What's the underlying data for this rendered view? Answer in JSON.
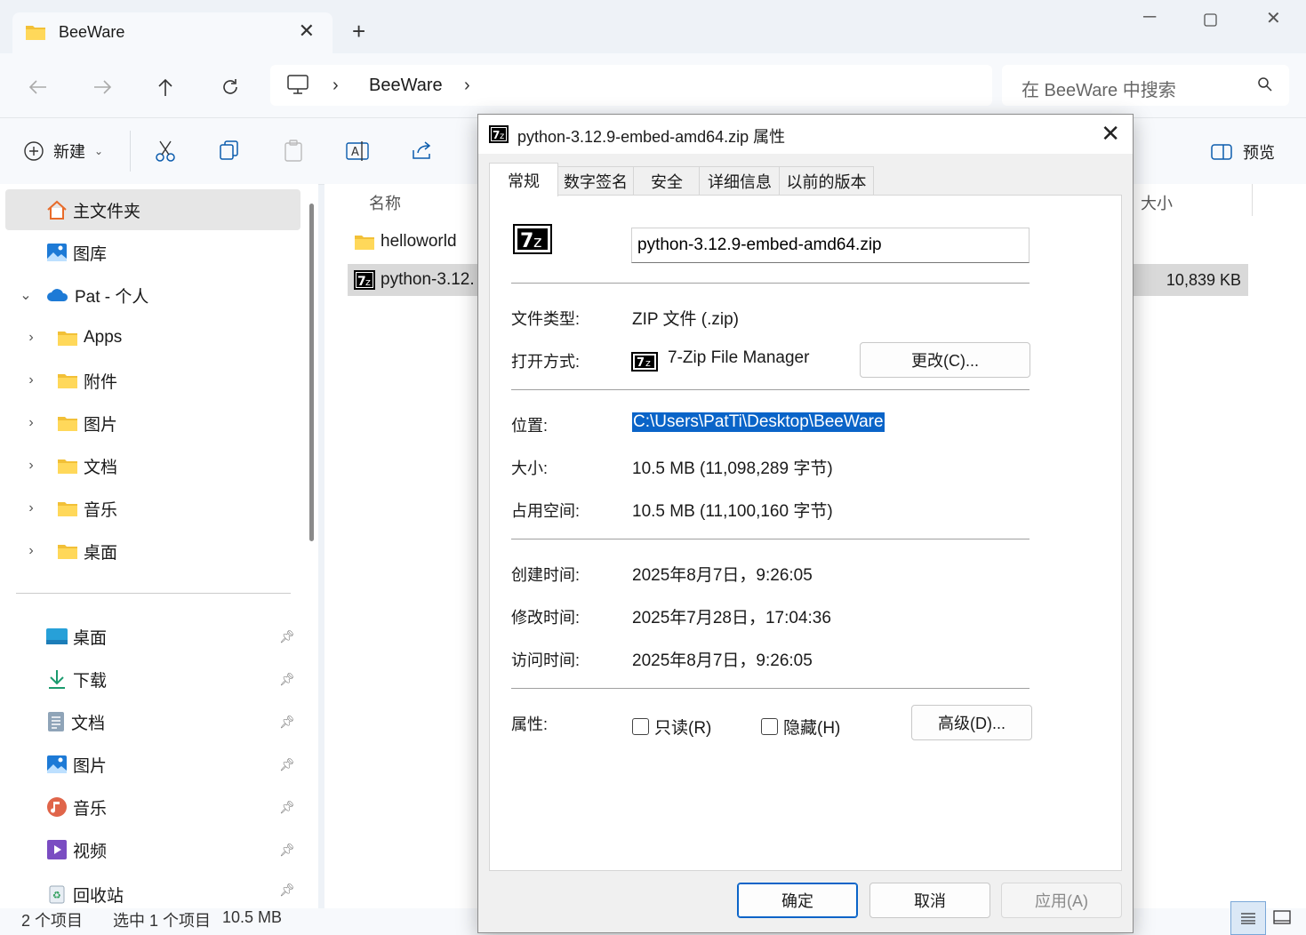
{
  "window": {
    "tab_title": "BeeWare",
    "new_tab": "+"
  },
  "nav": {
    "breadcrumb": "BeeWare",
    "search_placeholder": "在 BeeWare 中搜索"
  },
  "toolbar": {
    "new_label": "新建",
    "preview_label": "预览"
  },
  "sidebar": {
    "items": [
      {
        "label": "主文件夹"
      },
      {
        "label": "图库"
      },
      {
        "label": "Pat - 个人"
      },
      {
        "label": "Apps"
      },
      {
        "label": "附件"
      },
      {
        "label": "图片"
      },
      {
        "label": "文档"
      },
      {
        "label": "音乐"
      },
      {
        "label": "桌面"
      }
    ],
    "quick": [
      {
        "label": "桌面"
      },
      {
        "label": "下载"
      },
      {
        "label": "文档"
      },
      {
        "label": "图片"
      },
      {
        "label": "音乐"
      },
      {
        "label": "视频"
      },
      {
        "label": "回收站"
      }
    ]
  },
  "filelist": {
    "col_name": "名称",
    "col_size": "大小",
    "rows": [
      {
        "name": "helloworld",
        "size": ""
      },
      {
        "name": "python-3.12.",
        "size": "10,839 KB"
      }
    ]
  },
  "status": {
    "count": "2 个项目",
    "selected": "选中 1 个项目",
    "size": "10.5 MB"
  },
  "dialog": {
    "title": "python-3.12.9-embed-amd64.zip 属性",
    "tabs": [
      "常规",
      "数字签名",
      "安全",
      "详细信息",
      "以前的版本"
    ],
    "filename": "python-3.12.9-embed-amd64.zip",
    "type_label": "文件类型:",
    "type_value": "ZIP 文件 (.zip)",
    "open_label": "打开方式:",
    "open_value": "7-Zip File Manager",
    "change_btn": "更改(C)...",
    "location_label": "位置:",
    "location_value": "C:\\Users\\PatTi\\Desktop\\BeeWare",
    "size_label": "大小:",
    "size_value": "10.5 MB (11,098,289 字节)",
    "disk_label": "占用空间:",
    "disk_value": "10.5 MB (11,100,160 字节)",
    "created_label": "创建时间:",
    "created_value": "2025年8月7日，9:26:05",
    "modified_label": "修改时间:",
    "modified_value": "2025年7月28日，17:04:36",
    "accessed_label": "访问时间:",
    "accessed_value": "2025年8月7日，9:26:05",
    "attr_label": "属性:",
    "readonly_label": "只读(R)",
    "hidden_label": "隐藏(H)",
    "advanced_btn": "高级(D)...",
    "ok_btn": "确定",
    "cancel_btn": "取消",
    "apply_btn": "应用(A)"
  }
}
